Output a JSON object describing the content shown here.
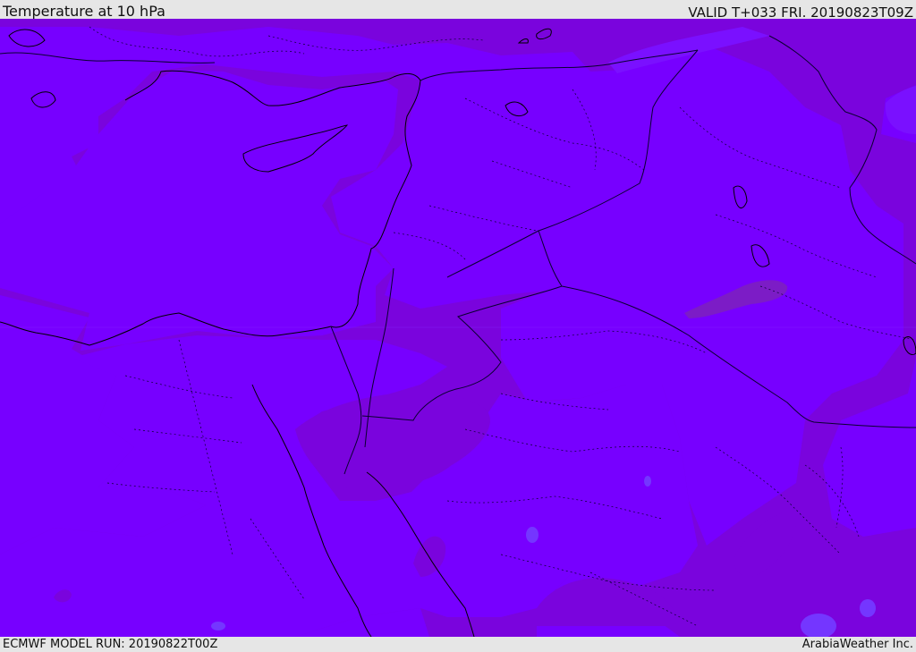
{
  "header": {
    "title": "Temperature at 10 hPa",
    "valid_time": "VALID T+033 FRI. 20190823T09Z"
  },
  "footer": {
    "model_run": "ECMWF MODEL RUN: 20190822T00Z",
    "provider": "ArabiaWeather Inc."
  },
  "map": {
    "colors": {
      "base_field": "#7700ff",
      "warm_band": "#7a04dd",
      "warmest_patch": "#7c1cc6",
      "cool_patch": "#7436ff",
      "coastline": "#000000",
      "border": "#0a0030"
    }
  }
}
